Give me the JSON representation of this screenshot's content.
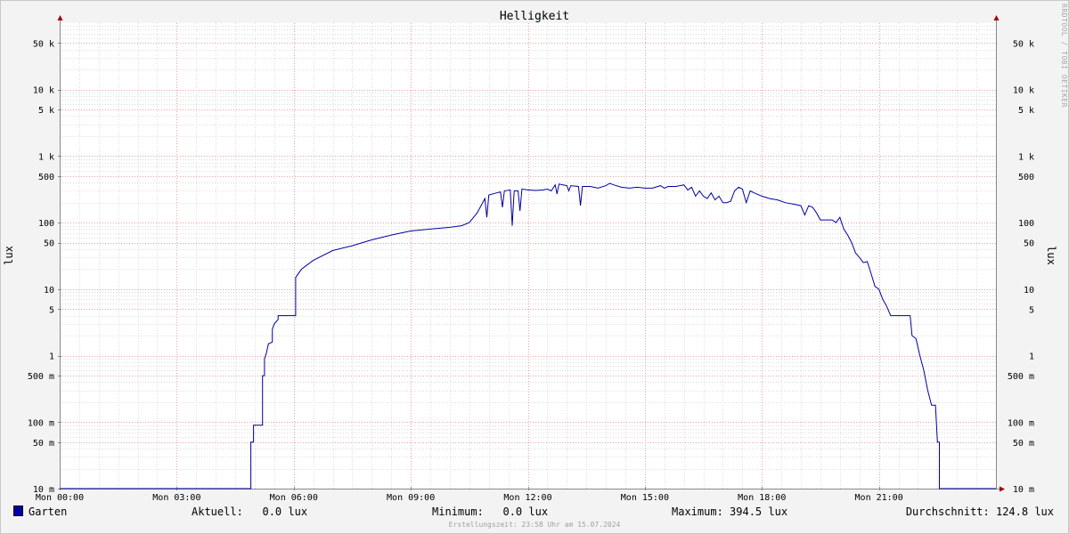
{
  "chart_data": {
    "type": "line",
    "title": "Helligkeit",
    "ylabel": "lux",
    "yscale": "log",
    "ylim": [
      0.01,
      100000
    ],
    "xlim_hours": [
      0,
      24
    ],
    "grid": true,
    "x_ticks": [
      {
        "hour": 0,
        "label": "Mon 00:00"
      },
      {
        "hour": 3,
        "label": "Mon 03:00"
      },
      {
        "hour": 6,
        "label": "Mon 06:00"
      },
      {
        "hour": 9,
        "label": "Mon 09:00"
      },
      {
        "hour": 12,
        "label": "Mon 12:00"
      },
      {
        "hour": 15,
        "label": "Mon 15:00"
      },
      {
        "hour": 18,
        "label": "Mon 18:00"
      },
      {
        "hour": 21,
        "label": "Mon 21:00"
      }
    ],
    "y_ticks": [
      {
        "value": 0.01,
        "label": "10 m"
      },
      {
        "value": 0.05,
        "label": "50 m"
      },
      {
        "value": 0.1,
        "label": "100 m"
      },
      {
        "value": 0.5,
        "label": "500 m"
      },
      {
        "value": 1,
        "label": "1"
      },
      {
        "value": 5,
        "label": "5"
      },
      {
        "value": 10,
        "label": "10"
      },
      {
        "value": 50,
        "label": "50"
      },
      {
        "value": 100,
        "label": "100"
      },
      {
        "value": 500,
        "label": "500"
      },
      {
        "value": 1000,
        "label": "1 k"
      },
      {
        "value": 5000,
        "label": "5 k"
      },
      {
        "value": 10000,
        "label": "10 k"
      },
      {
        "value": 50000,
        "label": "50 k"
      }
    ],
    "series": [
      {
        "name": "Garten",
        "color": "#0000a0",
        "points": [
          [
            0.0,
            0.01
          ],
          [
            4.9,
            0.01
          ],
          [
            4.9,
            0.05
          ],
          [
            4.97,
            0.05
          ],
          [
            4.97,
            0.09
          ],
          [
            5.2,
            0.09
          ],
          [
            5.2,
            0.5
          ],
          [
            5.25,
            0.5
          ],
          [
            5.25,
            0.9
          ],
          [
            5.3,
            1.1
          ],
          [
            5.35,
            1.5
          ],
          [
            5.45,
            1.6
          ],
          [
            5.45,
            2.5
          ],
          [
            5.5,
            3.0
          ],
          [
            5.6,
            3.5
          ],
          [
            5.6,
            4.0
          ],
          [
            6.05,
            4.0
          ],
          [
            6.05,
            15
          ],
          [
            6.2,
            20
          ],
          [
            6.5,
            27
          ],
          [
            7.0,
            38
          ],
          [
            7.5,
            45
          ],
          [
            8.0,
            55
          ],
          [
            8.5,
            65
          ],
          [
            9.0,
            75
          ],
          [
            9.5,
            80
          ],
          [
            10.0,
            85
          ],
          [
            10.3,
            90
          ],
          [
            10.5,
            100
          ],
          [
            10.7,
            140
          ],
          [
            10.8,
            180
          ],
          [
            10.9,
            230
          ],
          [
            10.95,
            120
          ],
          [
            11.0,
            260
          ],
          [
            11.2,
            280
          ],
          [
            11.3,
            290
          ],
          [
            11.35,
            170
          ],
          [
            11.4,
            300
          ],
          [
            11.55,
            310
          ],
          [
            11.6,
            90
          ],
          [
            11.65,
            300
          ],
          [
            11.75,
            300
          ],
          [
            11.8,
            150
          ],
          [
            11.85,
            320
          ],
          [
            12.0,
            310
          ],
          [
            12.2,
            305
          ],
          [
            12.4,
            310
          ],
          [
            12.5,
            320
          ],
          [
            12.6,
            300
          ],
          [
            12.7,
            370
          ],
          [
            12.75,
            270
          ],
          [
            12.8,
            380
          ],
          [
            12.9,
            370
          ],
          [
            13.0,
            360
          ],
          [
            13.05,
            300
          ],
          [
            13.1,
            360
          ],
          [
            13.3,
            350
          ],
          [
            13.35,
            180
          ],
          [
            13.4,
            350
          ],
          [
            13.6,
            350
          ],
          [
            13.8,
            330
          ],
          [
            14.0,
            360
          ],
          [
            14.1,
            390
          ],
          [
            14.2,
            370
          ],
          [
            14.4,
            340
          ],
          [
            14.6,
            330
          ],
          [
            14.8,
            340
          ],
          [
            15.0,
            330
          ],
          [
            15.2,
            330
          ],
          [
            15.4,
            360
          ],
          [
            15.5,
            330
          ],
          [
            15.6,
            350
          ],
          [
            15.8,
            350
          ],
          [
            16.0,
            370
          ],
          [
            16.1,
            310
          ],
          [
            16.2,
            340
          ],
          [
            16.3,
            250
          ],
          [
            16.4,
            300
          ],
          [
            16.5,
            250
          ],
          [
            16.6,
            230
          ],
          [
            16.7,
            280
          ],
          [
            16.8,
            220
          ],
          [
            16.9,
            250
          ],
          [
            17.0,
            200
          ],
          [
            17.1,
            200
          ],
          [
            17.2,
            210
          ],
          [
            17.3,
            300
          ],
          [
            17.4,
            340
          ],
          [
            17.5,
            320
          ],
          [
            17.6,
            200
          ],
          [
            17.7,
            300
          ],
          [
            17.8,
            280
          ],
          [
            18.0,
            250
          ],
          [
            18.2,
            230
          ],
          [
            18.4,
            220
          ],
          [
            18.6,
            200
          ],
          [
            18.8,
            190
          ],
          [
            19.0,
            180
          ],
          [
            19.1,
            130
          ],
          [
            19.2,
            180
          ],
          [
            19.3,
            170
          ],
          [
            19.4,
            140
          ],
          [
            19.5,
            110
          ],
          [
            19.8,
            110
          ],
          [
            19.9,
            100
          ],
          [
            20.0,
            120
          ],
          [
            20.1,
            80
          ],
          [
            20.2,
            65
          ],
          [
            20.3,
            50
          ],
          [
            20.4,
            35
          ],
          [
            20.5,
            30
          ],
          [
            20.6,
            25
          ],
          [
            20.7,
            26
          ],
          [
            20.8,
            17
          ],
          [
            20.9,
            11
          ],
          [
            21.0,
            10
          ],
          [
            21.1,
            7
          ],
          [
            21.2,
            5.5
          ],
          [
            21.3,
            4.0
          ],
          [
            21.8,
            4.0
          ],
          [
            21.85,
            2.0
          ],
          [
            21.95,
            1.8
          ],
          [
            22.05,
            1.0
          ],
          [
            22.15,
            0.6
          ],
          [
            22.25,
            0.3
          ],
          [
            22.35,
            0.18
          ],
          [
            22.45,
            0.18
          ],
          [
            22.5,
            0.05
          ],
          [
            22.55,
            0.05
          ],
          [
            22.55,
            0.01
          ],
          [
            24.0,
            0.01
          ]
        ]
      }
    ]
  },
  "legend": {
    "series_name": "Garten",
    "current": "Aktuell:   0.0 lux",
    "minimum": "Minimum:   0.0 lux",
    "maximum": "Maximum: 394.5 lux",
    "average": "Durchschnitt: 124.8 lux"
  },
  "watermark": "RRDTOOL / TOBI OETIKER",
  "footer": "Erstellungszeit: 23:58 Uhr am 15.07.2024"
}
